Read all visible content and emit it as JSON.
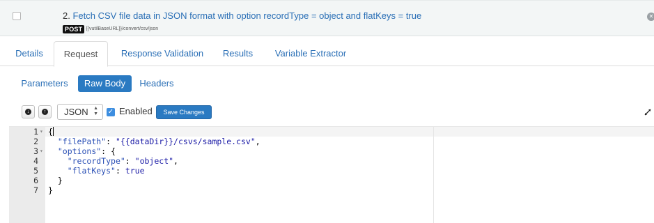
{
  "header": {
    "number": "2.",
    "title": "Fetch CSV file data in JSON format with option recordType = object and flatKeys = true",
    "method": "POST",
    "url": "{{vutilBaseURL}}/convert/csv/json"
  },
  "tabs": [
    {
      "label": "Details"
    },
    {
      "label": "Request"
    },
    {
      "label": "Response Validation"
    },
    {
      "label": "Results"
    },
    {
      "label": "Variable Extractor"
    }
  ],
  "subtabs": [
    {
      "label": "Parameters"
    },
    {
      "label": "Raw Body"
    },
    {
      "label": "Headers"
    }
  ],
  "toolbar": {
    "format_value": "JSON",
    "enabled_label": "Enabled",
    "enabled_checked": true,
    "save_label": "Save Changes"
  },
  "editor": {
    "line_numbers": [
      "1",
      "2",
      "3",
      "4",
      "5",
      "6",
      "7"
    ],
    "lines": [
      [
        {
          "t": "punc",
          "v": "{"
        }
      ],
      [
        {
          "t": "punc",
          "v": "  "
        },
        {
          "t": "key",
          "v": "\"filePath\""
        },
        {
          "t": "punc",
          "v": ": "
        },
        {
          "t": "str",
          "v": "\"{{dataDir}}/csvs/sample.csv\""
        },
        {
          "t": "punc",
          "v": ","
        }
      ],
      [
        {
          "t": "punc",
          "v": "  "
        },
        {
          "t": "key",
          "v": "\"options\""
        },
        {
          "t": "punc",
          "v": ": {"
        }
      ],
      [
        {
          "t": "punc",
          "v": "    "
        },
        {
          "t": "key",
          "v": "\"recordType\""
        },
        {
          "t": "punc",
          "v": ": "
        },
        {
          "t": "str",
          "v": "\"object\""
        },
        {
          "t": "punc",
          "v": ","
        }
      ],
      [
        {
          "t": "punc",
          "v": "    "
        },
        {
          "t": "key",
          "v": "\"flatKeys\""
        },
        {
          "t": "punc",
          "v": ": "
        },
        {
          "t": "bool",
          "v": "true"
        }
      ],
      [
        {
          "t": "punc",
          "v": "  }"
        }
      ],
      [
        {
          "t": "punc",
          "v": "}"
        }
      ]
    ]
  },
  "colors": {
    "link": "#2a6fb6",
    "primary": "#2a7ac2",
    "header_bg": "#f3f6f6"
  }
}
